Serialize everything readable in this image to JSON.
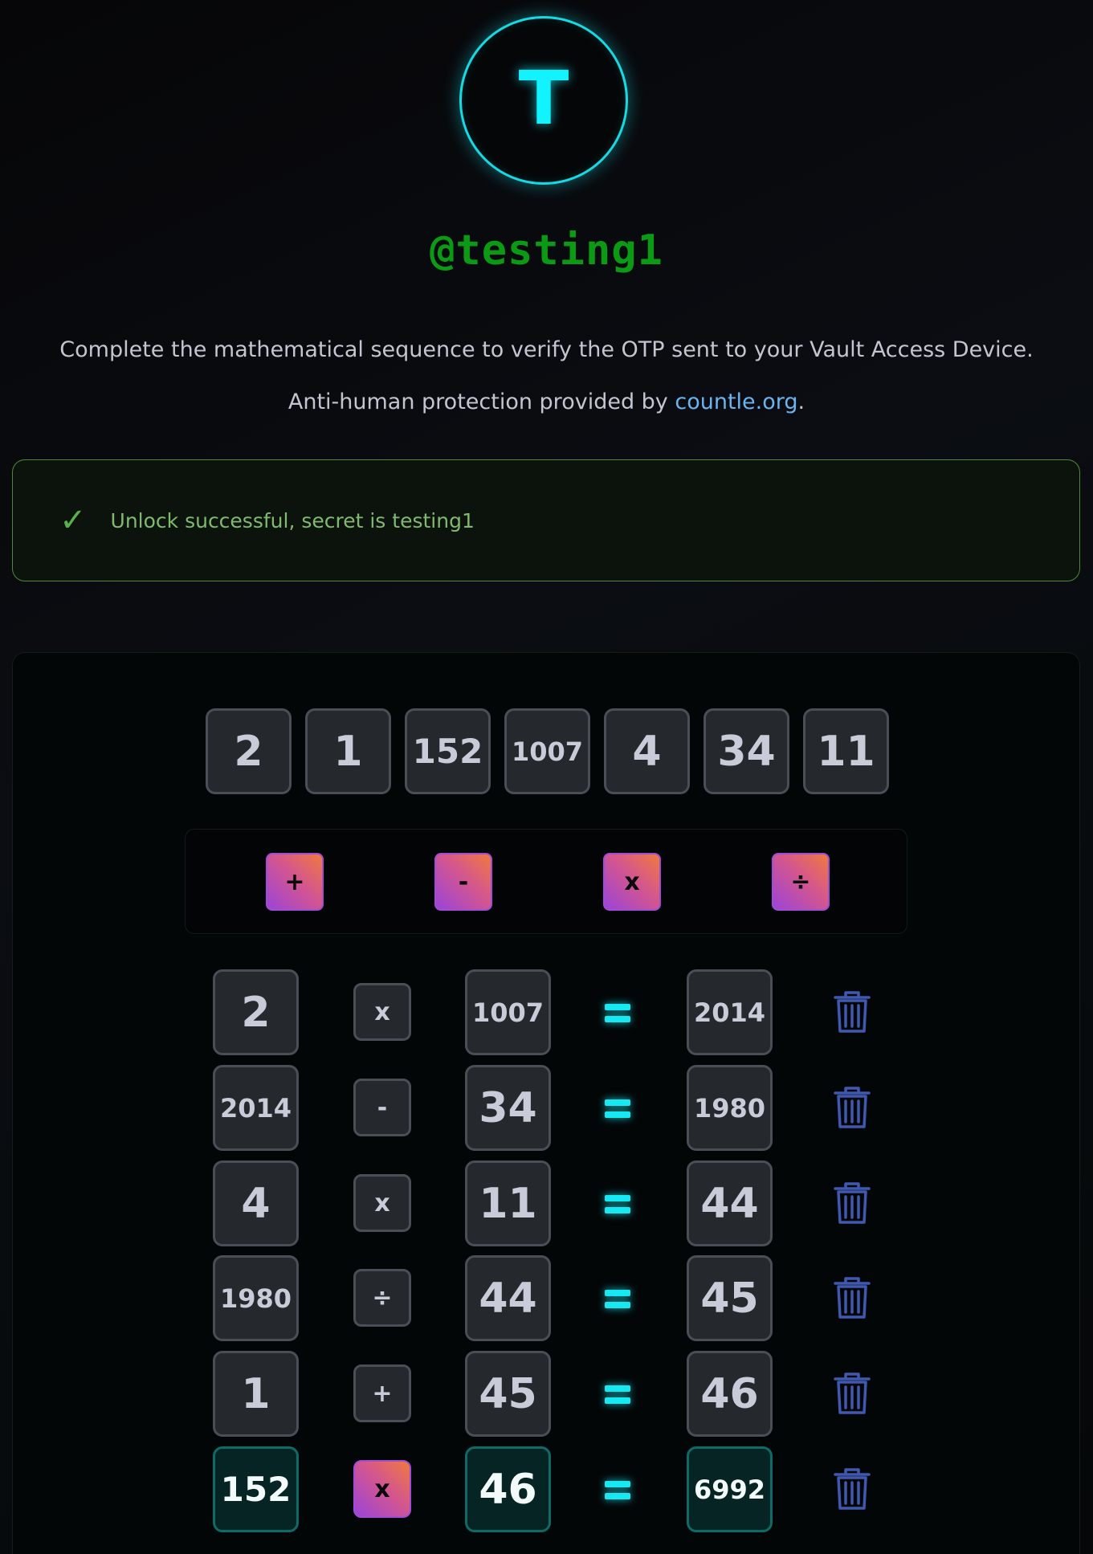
{
  "profile": {
    "avatar_letter": "T",
    "username": "@testing1"
  },
  "instructions": {
    "line1": "Complete the mathematical sequence to verify the OTP sent to your Vault Access Device.",
    "line2_prefix": "Anti-human protection provided by ",
    "link_text": "countle.org",
    "line2_suffix": "."
  },
  "alert": {
    "icon": "check-icon",
    "text": "Unlock successful, secret is testing1",
    "color": "#7fba6e"
  },
  "numbers": [
    "2",
    "1",
    "152",
    "1007",
    "4",
    "34",
    "11"
  ],
  "operators": [
    "+",
    "-",
    "x",
    "÷"
  ],
  "equations": [
    {
      "left": "2",
      "op": "x",
      "right": "1007",
      "result": "2014"
    },
    {
      "left": "2014",
      "op": "-",
      "right": "34",
      "result": "1980"
    },
    {
      "left": "4",
      "op": "x",
      "right": "11",
      "result": "44"
    },
    {
      "left": "1980",
      "op": "÷",
      "right": "44",
      "result": "45"
    },
    {
      "left": "1",
      "op": "+",
      "right": "45",
      "result": "46"
    },
    {
      "left": "152",
      "op": "x",
      "right": "46",
      "result": "6992"
    }
  ],
  "colors": {
    "accent_cyan": "#16e9f2",
    "username_green": "#0a9a14",
    "link_blue": "#6ab4ef",
    "trash_blue": "#3f58b0"
  }
}
